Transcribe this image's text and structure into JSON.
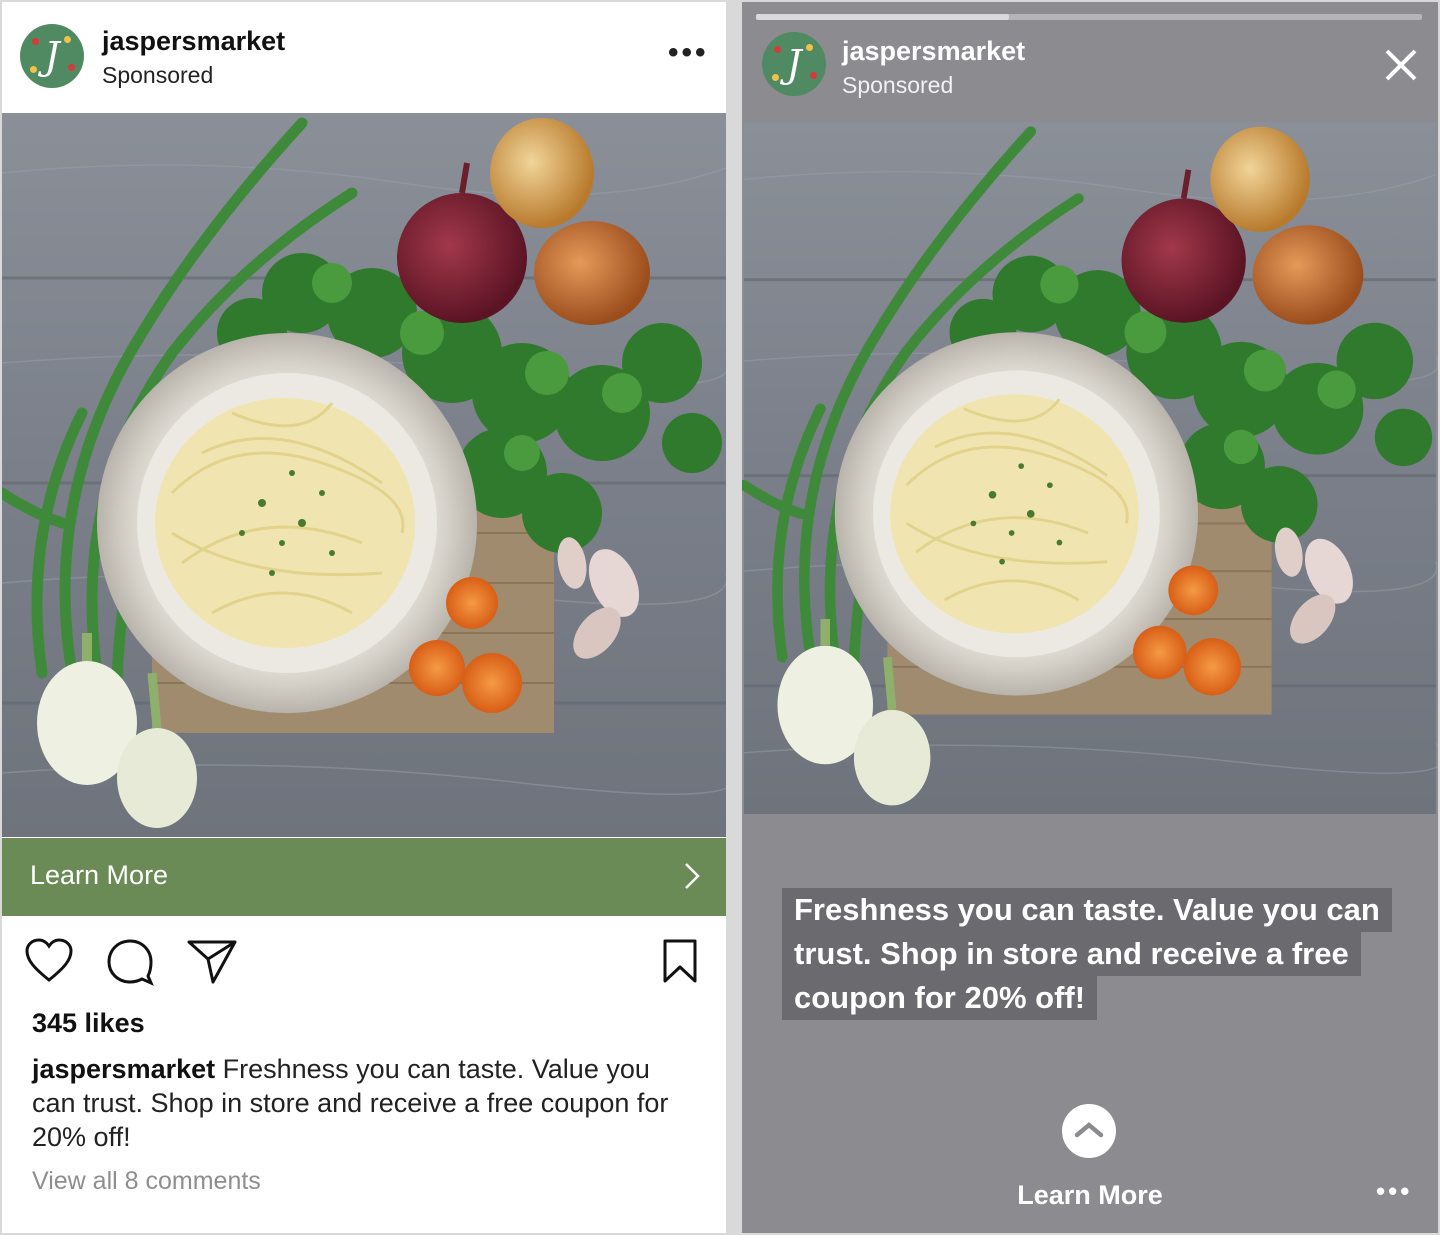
{
  "feed_post": {
    "account": {
      "username": "jaspersmarket",
      "sponsored_label": "Sponsored",
      "avatar_letter": "J"
    },
    "more_icon": "more-options-icon",
    "cta": {
      "label": "Learn More",
      "icon": "chevron-right-icon"
    },
    "actions": [
      "heart-icon",
      "comment-icon",
      "share-icon",
      "bookmark-icon"
    ],
    "likes": "345 likes",
    "caption": {
      "username": "jaspersmarket",
      "text": " Freshness you can taste. Value you can trust. Shop in store and receive a free coupon for 20% off!"
    },
    "view_comments": "View all 8 comments"
  },
  "story_ad": {
    "account": {
      "username": "jaspersmarket",
      "sponsored_label": "Sponsored",
      "avatar_letter": "J"
    },
    "progress": 0.38,
    "close_icon": "close-icon",
    "text_lines": [
      "Freshness you can taste. Value you can",
      "trust. Shop in store and receive a free",
      "coupon for 20% off!"
    ],
    "swipe_icon": "chevron-up-icon",
    "cta_label": "Learn More",
    "more_icon": "more-options-icon"
  },
  "colors": {
    "cta_green": "#6b8b56",
    "story_bg": "#8c8b8f",
    "avatar_green": "#4f8a63",
    "wood": "#7e838d"
  }
}
